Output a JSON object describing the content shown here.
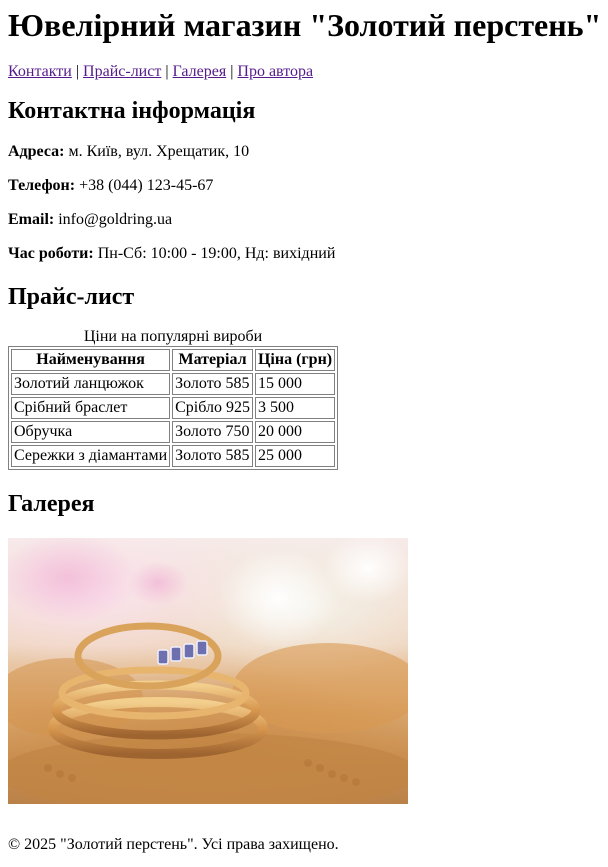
{
  "header": {
    "title": "Ювелірний магазин \"Золотий перстень\""
  },
  "nav": {
    "links": [
      "Контакти",
      "Прайс-лист",
      "Галерея",
      "Про автора"
    ],
    "separator": "|"
  },
  "contact": {
    "heading": "Контактна інформація",
    "address_label": "Адреса:",
    "address_value": "м. Київ, вул. Хрещатик, 10",
    "phone_label": "Телефон:",
    "phone_value": "+38 (044) 123-45-67",
    "email_label": "Email:",
    "email_value": "info@goldring.ua",
    "hours_label": "Час роботи:",
    "hours_value": "Пн-Сб: 10:00 - 19:00, Нд: вихідний"
  },
  "price": {
    "heading": "Прайс-лист",
    "caption": "Ціни на популярні вироби",
    "headers": [
      "Найменування",
      "Матеріал",
      "Ціна (грн)"
    ],
    "rows": [
      [
        "Золотий ланцюжок",
        "Золото 585",
        "15 000"
      ],
      [
        "Срібний браслет",
        "Срібло 925",
        "3 500"
      ],
      [
        "Обручка",
        "Золото 750",
        "20 000"
      ],
      [
        "Сережки з діамантами",
        "Золото 585",
        "25 000"
      ]
    ]
  },
  "gallery": {
    "heading": "Галерея",
    "image_subject": "gold-rings-jewelry-photo"
  },
  "footer": {
    "text": "© 2025 \"Золотий перстень\". Усі права захищено."
  },
  "colors": {
    "link": "#551a8b",
    "table_border": "#808080",
    "gold": "#c88d4d"
  }
}
